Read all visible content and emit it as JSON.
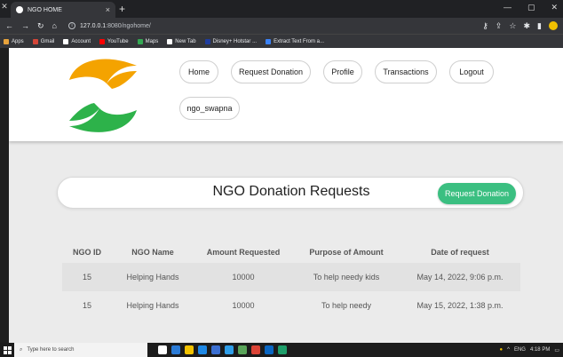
{
  "browser": {
    "tab_title": "NGO HOME",
    "tab_close": "×",
    "new_tab": "+",
    "url_host": "127.0.0.1",
    "url_path": ":8080/ngohome/",
    "bookmarks": [
      {
        "label": "Apps",
        "color": "#e8a33c"
      },
      {
        "label": "Gmail",
        "color": "#d44638"
      },
      {
        "label": "Account",
        "color": "#ffffff"
      },
      {
        "label": "YouTube",
        "color": "#ff0000"
      },
      {
        "label": "Maps",
        "color": "#34a853"
      },
      {
        "label": "New Tab",
        "color": "#ffffff"
      },
      {
        "label": "Disney+ Hotstar ...",
        "color": "#1f3d9e"
      },
      {
        "label": "Extract Text From a...",
        "color": "#3b82f6"
      }
    ]
  },
  "nav": {
    "home": "Home",
    "request_donation": "Request Donation",
    "profile": "Profile",
    "transactions": "Transactions",
    "logout": "Logout",
    "username": "ngo_swapna"
  },
  "main": {
    "title": "NGO Donation Requests",
    "request_button": "Request Donation"
  },
  "table": {
    "headers": [
      "NGO ID",
      "NGO Name",
      "Amount Requested",
      "Purpose of Amount",
      "Date of request"
    ],
    "rows": [
      [
        "15",
        "Helping Hands",
        "10000",
        "To help needy kids",
        "May 14, 2022, 9:06 p.m."
      ],
      [
        "15",
        "Helping Hands",
        "10000",
        "To help needy",
        "May 15, 2022, 1:38 p.m."
      ]
    ]
  },
  "taskbar": {
    "search_placeholder": "Type here to search",
    "tray_lang": "ENG",
    "time": "4:18 PM"
  },
  "colors": {
    "accent_green": "#3bbf81",
    "logo_orange": "#f4a300",
    "logo_green": "#2db24a"
  }
}
